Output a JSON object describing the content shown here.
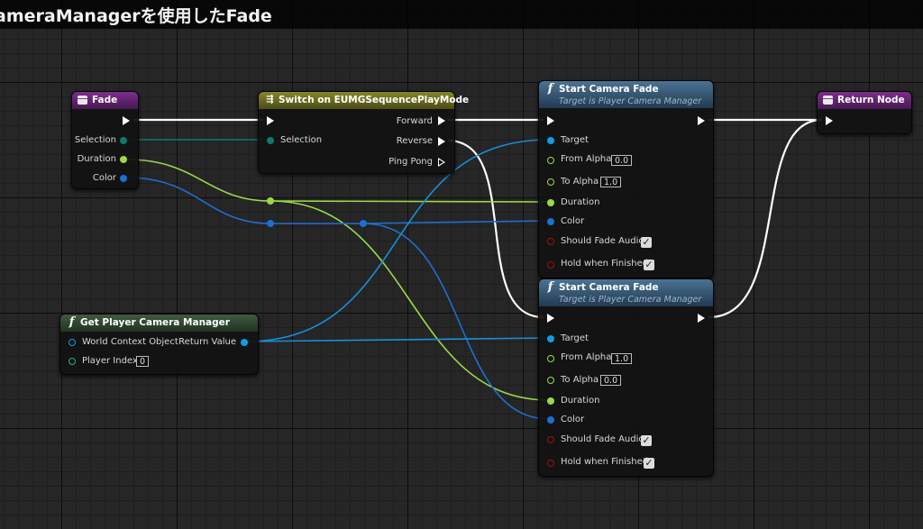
{
  "title": "ameraManagerを使用したFade",
  "colors": {
    "exec": "#ffffff",
    "teal": "#0d8a80",
    "green": "#9ad94a",
    "blue": "#1e6fd0",
    "bool": "#8b0000",
    "object": "#0a9fe6"
  },
  "nodes": {
    "fade_event": {
      "title": "Fade",
      "icon": "event-icon",
      "pins": {
        "selection": "Selection",
        "duration": "Duration",
        "color": "Color"
      }
    },
    "switch": {
      "title": "Switch on EUMGSequencePlayMode",
      "icon": "switch-icon",
      "pins": {
        "selection": "Selection",
        "forward": "Forward",
        "reverse": "Reverse",
        "ping_pong": "Ping Pong"
      }
    },
    "camera_fade_1": {
      "title": "Start Camera Fade",
      "subtitle": "Target is Player Camera Manager",
      "icon": "function-icon",
      "pins": {
        "target": "Target",
        "from_alpha": "From Alpha",
        "from_alpha_value": "0.0",
        "to_alpha": "To Alpha",
        "to_alpha_value": "1.0",
        "duration": "Duration",
        "color": "Color",
        "should_fade_audio": "Should Fade Audio",
        "hold_when_finished": "Hold when Finished"
      }
    },
    "camera_fade_2": {
      "title": "Start Camera Fade",
      "subtitle": "Target is Player Camera Manager",
      "icon": "function-icon",
      "pins": {
        "target": "Target",
        "from_alpha": "From Alpha",
        "from_alpha_value": "1.0",
        "to_alpha": "To Alpha",
        "to_alpha_value": "0.0",
        "duration": "Duration",
        "color": "Color",
        "should_fade_audio": "Should Fade Audio",
        "hold_when_finished": "Hold when Finished"
      }
    },
    "return_node": {
      "title": "Return Node",
      "icon": "event-icon"
    },
    "get_camera_manager": {
      "title": "Get Player Camera Manager",
      "icon": "function-icon",
      "pins": {
        "world_context": "World Context Object",
        "return_value": "Return Value",
        "player_index": "Player Index",
        "player_index_value": "0"
      }
    }
  },
  "checkmark": "✓",
  "function_glyph": "f",
  "switch_glyph": "⇶"
}
